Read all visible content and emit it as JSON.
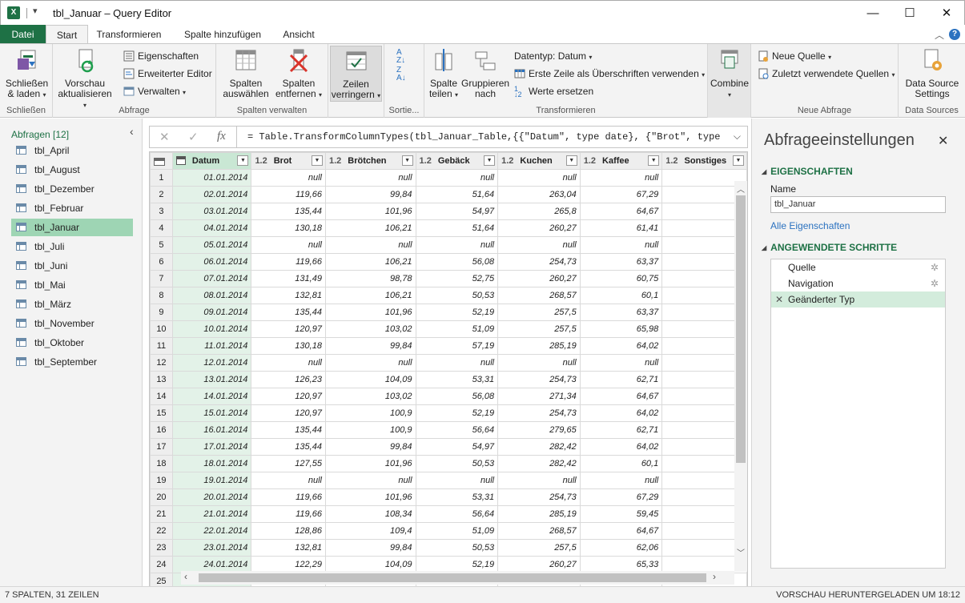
{
  "window": {
    "title": "tbl_Januar – Query Editor",
    "qat_label": "▾",
    "controls": {
      "minimize": "—",
      "maximize": "☐",
      "close": "✕"
    }
  },
  "ribbon_tabs": [
    "Datei",
    "Start",
    "Transformieren",
    "Spalte hinzufügen",
    "Ansicht"
  ],
  "ribbon": {
    "close_load": {
      "label_1": "Schließen",
      "label_2": "& laden",
      "group": "Schließen"
    },
    "refresh": {
      "label_1": "Vorschau",
      "label_2": "aktualisieren"
    },
    "properties": "Eigenschaften",
    "advanced_editor": "Erweiterter Editor",
    "manage": "Verwalten",
    "query_group": "Abfrage",
    "choose_columns": {
      "label_1": "Spalten",
      "label_2": "auswählen"
    },
    "remove_columns": {
      "label_1": "Spalten",
      "label_2": "entfernen"
    },
    "manage_columns_group": "Spalten verwalten",
    "reduce_rows": {
      "label_1": "Zeilen",
      "label_2": "verringern"
    },
    "sort_group": "Sortie...",
    "split_column": {
      "label_1": "Spalte",
      "label_2": "teilen"
    },
    "group_by": {
      "label_1": "Gruppieren",
      "label_2": "nach"
    },
    "data_type": "Datentyp: Datum",
    "first_row_headers": "Erste Zeile als Überschriften verwenden",
    "replace_values": "Werte ersetzen",
    "transform_group": "Transformieren",
    "combine": "Combine",
    "new_source": "Neue Quelle",
    "recent_sources": "Zuletzt verwendete Quellen",
    "new_query_group": "Neue Abfrage",
    "data_source_settings": {
      "label_1": "Data Source",
      "label_2": "Settings"
    },
    "data_sources_group": "Data Sources"
  },
  "queries": {
    "header": "Abfragen [12]",
    "items": [
      "tbl_April",
      "tbl_August",
      "tbl_Dezember",
      "tbl_Februar",
      "tbl_Januar",
      "tbl_Juli",
      "tbl_Juni",
      "tbl_Mai",
      "tbl_März",
      "tbl_November",
      "tbl_Oktober",
      "tbl_September"
    ],
    "selected": "tbl_Januar"
  },
  "formula": {
    "fx": "fx",
    "text": "= Table.TransformColumnTypes(tbl_Januar_Table,{{\"Datum\", type date}, {\"Brot\", type"
  },
  "table": {
    "columns": [
      {
        "type": "",
        "name": "Datum"
      },
      {
        "type": "1.2",
        "name": "Brot"
      },
      {
        "type": "1.2",
        "name": "Brötchen"
      },
      {
        "type": "1.2",
        "name": "Gebäck"
      },
      {
        "type": "1.2",
        "name": "Kuchen"
      },
      {
        "type": "1.2",
        "name": "Kaffee"
      },
      {
        "type": "1.2",
        "name": "Sonstiges"
      }
    ],
    "rows": [
      [
        "01.01.2014",
        "null",
        "null",
        "null",
        "null",
        "null"
      ],
      [
        "02.01.2014",
        "119,66",
        "99,84",
        "51,64",
        "263,04",
        "67,29"
      ],
      [
        "03.01.2014",
        "135,44",
        "101,96",
        "54,97",
        "265,8",
        "64,67"
      ],
      [
        "04.01.2014",
        "130,18",
        "106,21",
        "51,64",
        "260,27",
        "61,41"
      ],
      [
        "05.01.2014",
        "null",
        "null",
        "null",
        "null",
        "null"
      ],
      [
        "06.01.2014",
        "119,66",
        "106,21",
        "56,08",
        "254,73",
        "63,37"
      ],
      [
        "07.01.2014",
        "131,49",
        "98,78",
        "52,75",
        "260,27",
        "60,75"
      ],
      [
        "08.01.2014",
        "132,81",
        "106,21",
        "50,53",
        "268,57",
        "60,1"
      ],
      [
        "09.01.2014",
        "135,44",
        "101,96",
        "52,19",
        "257,5",
        "63,37"
      ],
      [
        "10.01.2014",
        "120,97",
        "103,02",
        "51,09",
        "257,5",
        "65,98"
      ],
      [
        "11.01.2014",
        "130,18",
        "99,84",
        "57,19",
        "285,19",
        "64,02"
      ],
      [
        "12.01.2014",
        "null",
        "null",
        "null",
        "null",
        "null"
      ],
      [
        "13.01.2014",
        "126,23",
        "104,09",
        "53,31",
        "254,73",
        "62,71"
      ],
      [
        "14.01.2014",
        "120,97",
        "103,02",
        "56,08",
        "271,34",
        "64,67"
      ],
      [
        "15.01.2014",
        "120,97",
        "100,9",
        "52,19",
        "254,73",
        "64,02"
      ],
      [
        "16.01.2014",
        "135,44",
        "100,9",
        "56,64",
        "279,65",
        "62,71"
      ],
      [
        "17.01.2014",
        "135,44",
        "99,84",
        "54,97",
        "282,42",
        "64,02"
      ],
      [
        "18.01.2014",
        "127,55",
        "101,96",
        "50,53",
        "282,42",
        "60,1"
      ],
      [
        "19.01.2014",
        "null",
        "null",
        "null",
        "null",
        "null"
      ],
      [
        "20.01.2014",
        "119,66",
        "101,96",
        "53,31",
        "254,73",
        "67,29"
      ],
      [
        "21.01.2014",
        "119,66",
        "108,34",
        "56,64",
        "285,19",
        "59,45"
      ],
      [
        "22.01.2014",
        "128,86",
        "109,4",
        "51,09",
        "268,57",
        "64,67"
      ],
      [
        "23.01.2014",
        "132,81",
        "99,84",
        "50,53",
        "257,5",
        "62,06"
      ],
      [
        "24.01.2014",
        "122,29",
        "104,09",
        "52,19",
        "260,27",
        "65,33"
      ]
    ],
    "last_row_number": "25"
  },
  "settings": {
    "title": "Abfrageeinstellungen",
    "close": "✕",
    "properties_header": "EIGENSCHAFTEN",
    "name_label": "Name",
    "name_value": "tbl_Januar",
    "all_properties": "Alle Eigenschaften",
    "steps_header": "ANGEWENDETE SCHRITTE",
    "steps": [
      "Quelle",
      "Navigation",
      "Geänderter Typ"
    ],
    "selected_step": "Geänderter Typ"
  },
  "status": {
    "left": "7 SPALTEN, 31 ZEILEN",
    "right": "VORSCHAU HERUNTERGELADEN UM 18:12"
  },
  "colors": {
    "accent": "#1e7145",
    "selected_query": "#9ed5b4",
    "link": "#2b72c0"
  },
  "icons": [
    "excel-logo-icon",
    "gear-icon",
    "close-icon",
    "delete-step-icon",
    "table-icon",
    "calendar-icon",
    "filter-icon",
    "sort-ascending-icon",
    "sort-descending-icon",
    "fx-icon",
    "cancel-icon",
    "check-icon"
  ]
}
